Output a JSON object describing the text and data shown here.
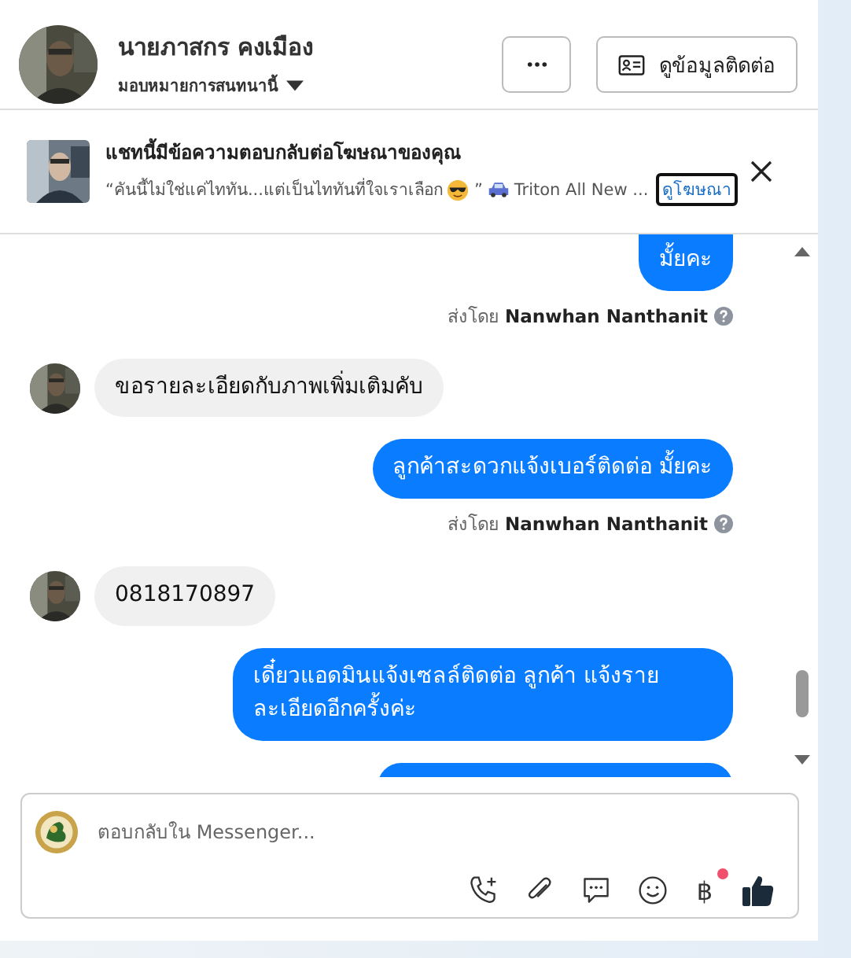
{
  "contact": {
    "name": "นายภาสกร คงเมือง",
    "assign_label": "มอบหมายการสนทนานี้"
  },
  "contact_button": {
    "label": "ดูข้อมูลติดต่อ"
  },
  "ad_banner": {
    "title": "แชทนี้มีข้อความตอบกลับต่อโฆษณาของคุณ",
    "snippet_parts": [
      "“คันนี้ไม่ใช่แค่ไททัน...แต่เป็นไททันที่ใจเราเลือก",
      "”",
      "Triton All New ..."
    ],
    "link": "ดูโฆษณา"
  },
  "messages": [
    {
      "kind": "outgoing",
      "text": "มั้ยคะ"
    },
    {
      "kind": "sent_by",
      "prefix": "ส่งโดย",
      "sender": "Nanwhan Nanthanit"
    },
    {
      "kind": "incoming",
      "text": "ขอรายละเอียดกับภาพเพิ่มเติมคับ"
    },
    {
      "kind": "outgoing",
      "text": "ลูกค้าสะดวกแจ้งเบอร์ติดต่อ มั้ยคะ"
    },
    {
      "kind": "sent_by",
      "prefix": "ส่งโดย",
      "sender": "Nanwhan Nanthanit"
    },
    {
      "kind": "incoming",
      "text": "0818170897"
    },
    {
      "kind": "outgoing",
      "text": "เดี๋ยวแอดมินแจ้งเซลล์ติดต่อ ลูกค้า  แจ้งรายละเอียดอีกครั้งค่ะ"
    },
    {
      "kind": "outgoing"
    }
  ],
  "composer": {
    "placeholder": "ตอบกลับใน Messenger...",
    "currency_symbol": "฿",
    "currency_badge": true
  }
}
